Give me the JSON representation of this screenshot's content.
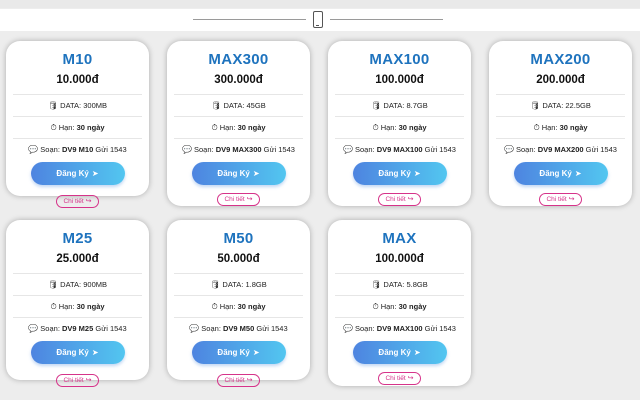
{
  "header": {
    "icon": "mobile-phone-icon"
  },
  "labels": {
    "data_prefix": "DATA:",
    "duration_prefix": "Hạn:",
    "sms_prefix": "Soạn:",
    "register": "Đăng Ký",
    "detail": "Chi tiết"
  },
  "icons": {
    "data": "database-icon",
    "duration": "clock-icon",
    "sms": "message-icon",
    "register": "send-arrow-icon",
    "detail": "share-icon"
  },
  "colors": {
    "plan_name": "#1e73be",
    "button_gradient_start": "#4e84e0",
    "button_gradient_end": "#52c6f0",
    "detail_border": "#d6338a"
  },
  "plans": [
    {
      "name": "M10",
      "price": "10.000đ",
      "data": "300MB",
      "duration": "30 ngày",
      "sms_code": "DV9 M10",
      "sms_suffix": "Gửi 1543"
    },
    {
      "name": "MAX300",
      "price": "300.000đ",
      "data": "45GB",
      "duration": "30 ngày",
      "sms_code": "DV9 MAX300",
      "sms_suffix": "Gửi 1543"
    },
    {
      "name": "MAX100",
      "price": "100.000đ",
      "data": "8.7GB",
      "duration": "30 ngày",
      "sms_code": "DV9 MAX100",
      "sms_suffix": "Gửi 1543"
    },
    {
      "name": "MAX200",
      "price": "200.000đ",
      "data": "22.5GB",
      "duration": "30 ngày",
      "sms_code": "DV9 MAX200",
      "sms_suffix": "Gửi 1543"
    },
    {
      "name": "M25",
      "price": "25.000đ",
      "data": "900MB",
      "duration": "30 ngày",
      "sms_code": "DV9 M25",
      "sms_suffix": "Gửi 1543"
    },
    {
      "name": "M50",
      "price": "50.000đ",
      "data": "1.8GB",
      "duration": "30 ngày",
      "sms_code": "DV9 M50",
      "sms_suffix": "Gửi 1543"
    },
    {
      "name": "MAX",
      "price": "100.000đ",
      "data": "5.8GB",
      "duration": "30 ngày",
      "sms_code": "DV9 MAX100",
      "sms_suffix": "Gửi 1543"
    }
  ]
}
